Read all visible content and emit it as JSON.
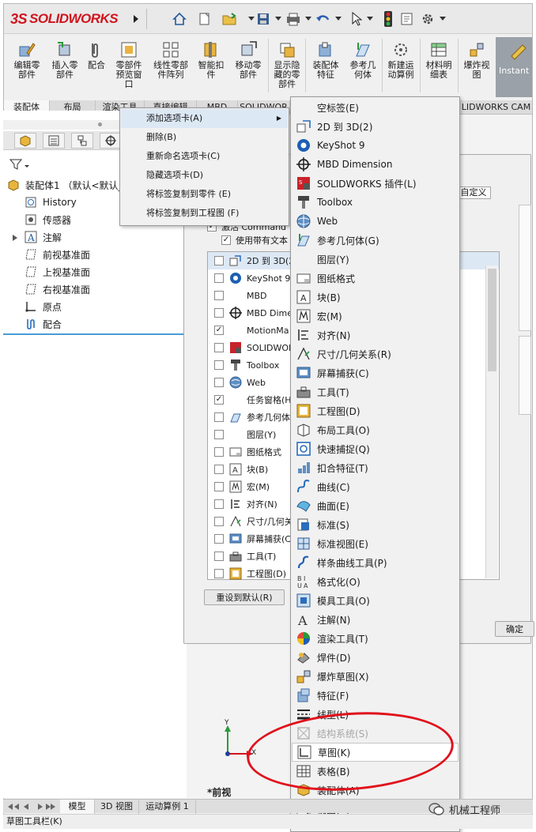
{
  "app": {
    "brand": "SOLIDWORKS",
    "brand_ds": "3S"
  },
  "ribbon": {
    "buttons": [
      {
        "label": "编辑零\n部件",
        "icon": "edit-component-icon"
      },
      {
        "label": "插入零\n部件",
        "icon": "insert-component-icon"
      },
      {
        "label": "配合",
        "icon": "mate-icon"
      },
      {
        "label": "零部件\n预览窗\n口",
        "icon": "component-preview-icon"
      },
      {
        "label": "线性零部\n件阵列",
        "icon": "linear-pattern-icon"
      },
      {
        "label": "智能扣\n件",
        "icon": "smart-fasteners-icon"
      },
      {
        "label": "移动零\n部件",
        "icon": "move-component-icon"
      },
      {
        "label": "显示隐\n藏的零\n部件",
        "icon": "show-hidden-icon"
      },
      {
        "label": "装配体\n特征",
        "icon": "assembly-features-icon"
      },
      {
        "label": "参考几\n何体",
        "icon": "reference-geometry-icon"
      },
      {
        "label": "新建运\n动算例",
        "icon": "new-motion-study-icon"
      },
      {
        "label": "材料明\n细表",
        "icon": "bom-icon"
      },
      {
        "label": "爆炸视\n图",
        "icon": "exploded-view-icon"
      }
    ],
    "instant": "Instant"
  },
  "tabs": [
    "装配体",
    "布局",
    "渲染工具",
    "直接编辑",
    "MBD",
    "SOLIDWOR",
    "LIDWORKS CAM"
  ],
  "tree": {
    "root": "装配体1 （默认<默认_",
    "items": [
      "History",
      "传感器",
      "注解",
      "前视基准面",
      "上视基准面",
      "右视基准面",
      "原点",
      "配合"
    ]
  },
  "context_menu": {
    "items": [
      "添加选项卡(A)",
      "删除(B)",
      "重新命名选项卡(C)",
      "隐藏选项卡(D)",
      "将标签复制到零件 (E)",
      "将标签复制到工程图 (F)"
    ]
  },
  "submenu": {
    "items": [
      {
        "label": "空标签(E)",
        "icon": ""
      },
      {
        "label": "2D 到 3D(2)",
        "icon": "2d-to-3d-icon"
      },
      {
        "label": "KeyShot 9",
        "icon": "keyshot-icon"
      },
      {
        "label": "MBD Dimension",
        "icon": "mbd-dimension-icon"
      },
      {
        "label": "SOLIDWORKS 插件(L)",
        "icon": "sw-addins-icon"
      },
      {
        "label": "Toolbox",
        "icon": "toolbox-icon"
      },
      {
        "label": "Web",
        "icon": "web-globe-icon"
      },
      {
        "label": "参考几何体(G)",
        "icon": "reference-geometry-icon"
      },
      {
        "label": "图层(Y)",
        "icon": ""
      },
      {
        "label": "图纸格式",
        "icon": "sheet-format-icon"
      },
      {
        "label": "块(B)",
        "icon": "block-icon"
      },
      {
        "label": "宏(M)",
        "icon": "macro-icon"
      },
      {
        "label": "对齐(N)",
        "icon": "align-icon"
      },
      {
        "label": "尺寸/几何关系(R)",
        "icon": "dimension-relations-icon"
      },
      {
        "label": "屏幕捕获(C)",
        "icon": "screen-capture-icon"
      },
      {
        "label": "工具(T)",
        "icon": "tools-icon"
      },
      {
        "label": "工程图(D)",
        "icon": "drawing-icon"
      },
      {
        "label": "布局工具(O)",
        "icon": "layout-tools-icon"
      },
      {
        "label": "快速捕捉(Q)",
        "icon": "quick-snaps-icon"
      },
      {
        "label": "扣合特征(T)",
        "icon": "fastening-features-icon"
      },
      {
        "label": "曲线(C)",
        "icon": "curves-icon"
      },
      {
        "label": "曲面(E)",
        "icon": "surfaces-icon"
      },
      {
        "label": "标准(S)",
        "icon": "standard-icon"
      },
      {
        "label": "标准视图(E)",
        "icon": "standard-views-icon"
      },
      {
        "label": "样条曲线工具(P)",
        "icon": "spline-tools-icon"
      },
      {
        "label": "格式化(O)",
        "icon": "formatting-icon"
      },
      {
        "label": "模具工具(O)",
        "icon": "mold-tools-icon"
      },
      {
        "label": "注解(N)",
        "icon": "annotation-icon"
      },
      {
        "label": "渲染工具(T)",
        "icon": "render-tools-icon"
      },
      {
        "label": "焊件(D)",
        "icon": "weldments-icon"
      },
      {
        "label": "爆炸草图(X)",
        "icon": "explode-sketch-icon"
      },
      {
        "label": "特征(F)",
        "icon": "features-icon"
      },
      {
        "label": "线型(L)",
        "icon": "line-format-icon"
      },
      {
        "label": "结构系统(S)",
        "icon": "structure-system-icon"
      },
      {
        "label": "草图(K)",
        "icon": "sketch-icon"
      },
      {
        "label": "表格(B)",
        "icon": "table-icon"
      },
      {
        "label": "装配体(A)",
        "icon": "assembly-icon"
      },
      {
        "label": "视图(V)",
        "icon": "view-icon"
      }
    ]
  },
  "dialog": {
    "options": [
      "激活 Command",
      "使用带有文本"
    ],
    "custom_tab": "自定义",
    "list": [
      {
        "label": "2D 到 3D(2",
        "checked": false
      },
      {
        "label": "KeyShot 9",
        "checked": false
      },
      {
        "label": "MBD",
        "checked": false
      },
      {
        "label": "MBD Dime",
        "checked": false
      },
      {
        "label": "MotionMa",
        "checked": true
      },
      {
        "label": "SOLIDWOF",
        "checked": false
      },
      {
        "label": "Toolbox",
        "checked": false
      },
      {
        "label": "Web",
        "checked": false
      },
      {
        "label": "任务窗格(H",
        "checked": true
      },
      {
        "label": "参考几何体",
        "checked": false
      },
      {
        "label": "图层(Y)",
        "checked": false
      },
      {
        "label": "图纸格式",
        "checked": false
      },
      {
        "label": "块(B)",
        "checked": false
      },
      {
        "label": "宏(M)",
        "checked": false
      },
      {
        "label": "对齐(N)",
        "checked": false
      },
      {
        "label": "尺寸/几何关",
        "checked": false
      },
      {
        "label": "屏幕捕获(C",
        "checked": false
      },
      {
        "label": "工具(T)",
        "checked": false
      },
      {
        "label": "工程图(D)",
        "checked": false
      }
    ],
    "reset_button": "重设到默认(R)",
    "ok_button": "确定"
  },
  "viewport": {
    "view_label": "*前视",
    "axis_y": "Y",
    "axis_x": "X"
  },
  "bottom_tabs": [
    "模型",
    "3D 视图",
    "运动算例 1"
  ],
  "status_text": "草图工具栏(K)",
  "watermark": "机械工程师",
  "colors": {
    "accent_red": "#e0121c",
    "brand_red": "#d0141e",
    "selection_blue": "#dde8f5"
  }
}
